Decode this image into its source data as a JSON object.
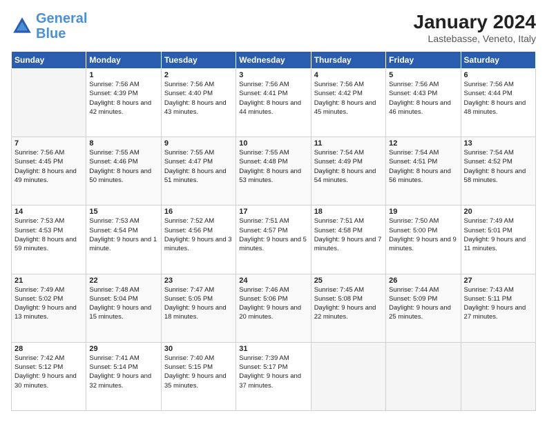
{
  "header": {
    "logo_line1": "General",
    "logo_line2": "Blue",
    "title": "January 2024",
    "subtitle": "Lastebasse, Veneto, Italy"
  },
  "weekdays": [
    "Sunday",
    "Monday",
    "Tuesday",
    "Wednesday",
    "Thursday",
    "Friday",
    "Saturday"
  ],
  "weeks": [
    [
      {
        "day": "",
        "empty": true
      },
      {
        "day": "1",
        "sunrise": "7:56 AM",
        "sunset": "4:39 PM",
        "daylight": "8 hours and 42 minutes."
      },
      {
        "day": "2",
        "sunrise": "7:56 AM",
        "sunset": "4:40 PM",
        "daylight": "8 hours and 43 minutes."
      },
      {
        "day": "3",
        "sunrise": "7:56 AM",
        "sunset": "4:41 PM",
        "daylight": "8 hours and 44 minutes."
      },
      {
        "day": "4",
        "sunrise": "7:56 AM",
        "sunset": "4:42 PM",
        "daylight": "8 hours and 45 minutes."
      },
      {
        "day": "5",
        "sunrise": "7:56 AM",
        "sunset": "4:43 PM",
        "daylight": "8 hours and 46 minutes."
      },
      {
        "day": "6",
        "sunrise": "7:56 AM",
        "sunset": "4:44 PM",
        "daylight": "8 hours and 48 minutes."
      }
    ],
    [
      {
        "day": "7",
        "sunrise": "7:56 AM",
        "sunset": "4:45 PM",
        "daylight": "8 hours and 49 minutes."
      },
      {
        "day": "8",
        "sunrise": "7:55 AM",
        "sunset": "4:46 PM",
        "daylight": "8 hours and 50 minutes."
      },
      {
        "day": "9",
        "sunrise": "7:55 AM",
        "sunset": "4:47 PM",
        "daylight": "8 hours and 51 minutes."
      },
      {
        "day": "10",
        "sunrise": "7:55 AM",
        "sunset": "4:48 PM",
        "daylight": "8 hours and 53 minutes."
      },
      {
        "day": "11",
        "sunrise": "7:54 AM",
        "sunset": "4:49 PM",
        "daylight": "8 hours and 54 minutes."
      },
      {
        "day": "12",
        "sunrise": "7:54 AM",
        "sunset": "4:51 PM",
        "daylight": "8 hours and 56 minutes."
      },
      {
        "day": "13",
        "sunrise": "7:54 AM",
        "sunset": "4:52 PM",
        "daylight": "8 hours and 58 minutes."
      }
    ],
    [
      {
        "day": "14",
        "sunrise": "7:53 AM",
        "sunset": "4:53 PM",
        "daylight": "8 hours and 59 minutes."
      },
      {
        "day": "15",
        "sunrise": "7:53 AM",
        "sunset": "4:54 PM",
        "daylight": "9 hours and 1 minute."
      },
      {
        "day": "16",
        "sunrise": "7:52 AM",
        "sunset": "4:56 PM",
        "daylight": "9 hours and 3 minutes."
      },
      {
        "day": "17",
        "sunrise": "7:51 AM",
        "sunset": "4:57 PM",
        "daylight": "9 hours and 5 minutes."
      },
      {
        "day": "18",
        "sunrise": "7:51 AM",
        "sunset": "4:58 PM",
        "daylight": "9 hours and 7 minutes."
      },
      {
        "day": "19",
        "sunrise": "7:50 AM",
        "sunset": "5:00 PM",
        "daylight": "9 hours and 9 minutes."
      },
      {
        "day": "20",
        "sunrise": "7:49 AM",
        "sunset": "5:01 PM",
        "daylight": "9 hours and 11 minutes."
      }
    ],
    [
      {
        "day": "21",
        "sunrise": "7:49 AM",
        "sunset": "5:02 PM",
        "daylight": "9 hours and 13 minutes."
      },
      {
        "day": "22",
        "sunrise": "7:48 AM",
        "sunset": "5:04 PM",
        "daylight": "9 hours and 15 minutes."
      },
      {
        "day": "23",
        "sunrise": "7:47 AM",
        "sunset": "5:05 PM",
        "daylight": "9 hours and 18 minutes."
      },
      {
        "day": "24",
        "sunrise": "7:46 AM",
        "sunset": "5:06 PM",
        "daylight": "9 hours and 20 minutes."
      },
      {
        "day": "25",
        "sunrise": "7:45 AM",
        "sunset": "5:08 PM",
        "daylight": "9 hours and 22 minutes."
      },
      {
        "day": "26",
        "sunrise": "7:44 AM",
        "sunset": "5:09 PM",
        "daylight": "9 hours and 25 minutes."
      },
      {
        "day": "27",
        "sunrise": "7:43 AM",
        "sunset": "5:11 PM",
        "daylight": "9 hours and 27 minutes."
      }
    ],
    [
      {
        "day": "28",
        "sunrise": "7:42 AM",
        "sunset": "5:12 PM",
        "daylight": "9 hours and 30 minutes."
      },
      {
        "day": "29",
        "sunrise": "7:41 AM",
        "sunset": "5:14 PM",
        "daylight": "9 hours and 32 minutes."
      },
      {
        "day": "30",
        "sunrise": "7:40 AM",
        "sunset": "5:15 PM",
        "daylight": "9 hours and 35 minutes."
      },
      {
        "day": "31",
        "sunrise": "7:39 AM",
        "sunset": "5:17 PM",
        "daylight": "9 hours and 37 minutes."
      },
      {
        "day": "",
        "empty": true
      },
      {
        "day": "",
        "empty": true
      },
      {
        "day": "",
        "empty": true
      }
    ]
  ],
  "labels": {
    "sunrise": "Sunrise:",
    "sunset": "Sunset:",
    "daylight": "Daylight:"
  }
}
